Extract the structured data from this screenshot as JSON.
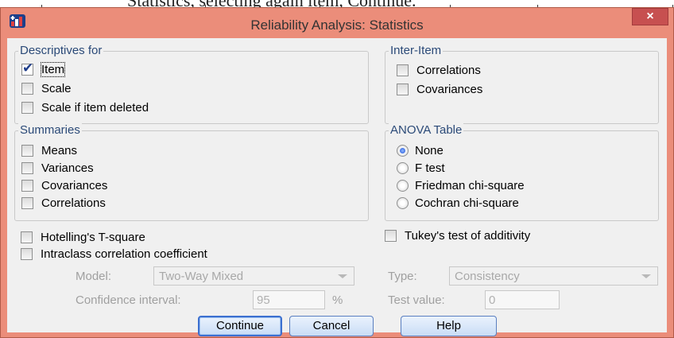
{
  "background_fragment": {
    "text": "Statistics, selecting again item,     Continue."
  },
  "window": {
    "title": "Reliability Analysis: Statistics",
    "close_glyph": "×"
  },
  "descriptives": {
    "legend": "Descriptives for",
    "items": [
      {
        "label": "Item",
        "checked": true
      },
      {
        "label": "Scale",
        "checked": false
      },
      {
        "label": "Scale if item deleted",
        "checked": false
      }
    ]
  },
  "inter_item": {
    "legend": "Inter-Item",
    "items": [
      {
        "label": "Correlations",
        "checked": false
      },
      {
        "label": "Covariances",
        "checked": false
      }
    ]
  },
  "summaries": {
    "legend": "Summaries",
    "items": [
      {
        "label": "Means",
        "checked": false
      },
      {
        "label": "Variances",
        "checked": false
      },
      {
        "label": "Covariances",
        "checked": false
      },
      {
        "label": "Correlations",
        "checked": false
      }
    ]
  },
  "anova": {
    "legend": "ANOVA Table",
    "options": [
      {
        "label": "None",
        "selected": true
      },
      {
        "label": "F test",
        "selected": false
      },
      {
        "label": "Friedman chi-square",
        "selected": false
      },
      {
        "label": "Cochran chi-square",
        "selected": false
      }
    ]
  },
  "options": {
    "hotelling": {
      "label": "Hotelling's T-square",
      "checked": false
    },
    "tukey": {
      "label": "Tukey's test of additivity",
      "checked": false
    },
    "intraclass": {
      "label": "Intraclass correlation coefficient",
      "checked": false
    }
  },
  "icc": {
    "model_label": "Model:",
    "model_value": "Two-Way Mixed",
    "type_label": "Type:",
    "type_value": "Consistency",
    "ci_label": "Confidence interval:",
    "ci_value": "95",
    "ci_unit": "%",
    "test_label": "Test value:",
    "test_value": "0"
  },
  "buttons": {
    "continue": "Continue",
    "cancel": "Cancel",
    "help": "Help"
  }
}
